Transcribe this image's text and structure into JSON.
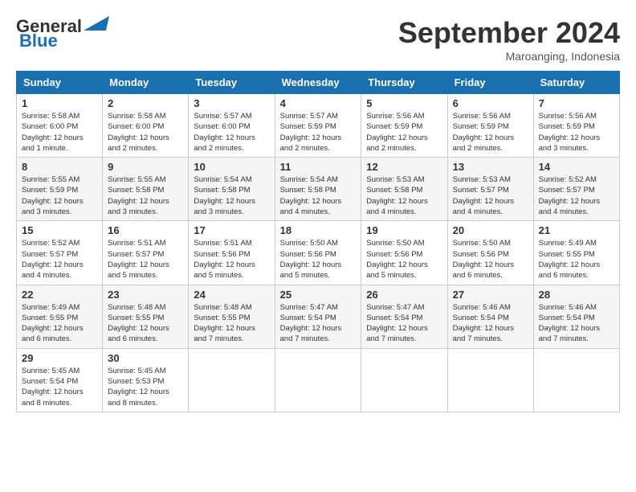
{
  "header": {
    "logo_general": "General",
    "logo_blue": "Blue",
    "month_title": "September 2024",
    "location": "Maroanging, Indonesia"
  },
  "days_of_week": [
    "Sunday",
    "Monday",
    "Tuesday",
    "Wednesday",
    "Thursday",
    "Friday",
    "Saturday"
  ],
  "weeks": [
    [
      {
        "day": "1",
        "sunrise": "5:58 AM",
        "sunset": "6:00 PM",
        "daylight": "12 hours and 1 minute."
      },
      {
        "day": "2",
        "sunrise": "5:58 AM",
        "sunset": "6:00 PM",
        "daylight": "12 hours and 2 minutes."
      },
      {
        "day": "3",
        "sunrise": "5:57 AM",
        "sunset": "6:00 PM",
        "daylight": "12 hours and 2 minutes."
      },
      {
        "day": "4",
        "sunrise": "5:57 AM",
        "sunset": "5:59 PM",
        "daylight": "12 hours and 2 minutes."
      },
      {
        "day": "5",
        "sunrise": "5:56 AM",
        "sunset": "5:59 PM",
        "daylight": "12 hours and 2 minutes."
      },
      {
        "day": "6",
        "sunrise": "5:56 AM",
        "sunset": "5:59 PM",
        "daylight": "12 hours and 2 minutes."
      },
      {
        "day": "7",
        "sunrise": "5:56 AM",
        "sunset": "5:59 PM",
        "daylight": "12 hours and 3 minutes."
      }
    ],
    [
      {
        "day": "8",
        "sunrise": "5:55 AM",
        "sunset": "5:59 PM",
        "daylight": "12 hours and 3 minutes."
      },
      {
        "day": "9",
        "sunrise": "5:55 AM",
        "sunset": "5:58 PM",
        "daylight": "12 hours and 3 minutes."
      },
      {
        "day": "10",
        "sunrise": "5:54 AM",
        "sunset": "5:58 PM",
        "daylight": "12 hours and 3 minutes."
      },
      {
        "day": "11",
        "sunrise": "5:54 AM",
        "sunset": "5:58 PM",
        "daylight": "12 hours and 4 minutes."
      },
      {
        "day": "12",
        "sunrise": "5:53 AM",
        "sunset": "5:58 PM",
        "daylight": "12 hours and 4 minutes."
      },
      {
        "day": "13",
        "sunrise": "5:53 AM",
        "sunset": "5:57 PM",
        "daylight": "12 hours and 4 minutes."
      },
      {
        "day": "14",
        "sunrise": "5:52 AM",
        "sunset": "5:57 PM",
        "daylight": "12 hours and 4 minutes."
      }
    ],
    [
      {
        "day": "15",
        "sunrise": "5:52 AM",
        "sunset": "5:57 PM",
        "daylight": "12 hours and 4 minutes."
      },
      {
        "day": "16",
        "sunrise": "5:51 AM",
        "sunset": "5:57 PM",
        "daylight": "12 hours and 5 minutes."
      },
      {
        "day": "17",
        "sunrise": "5:51 AM",
        "sunset": "5:56 PM",
        "daylight": "12 hours and 5 minutes."
      },
      {
        "day": "18",
        "sunrise": "5:50 AM",
        "sunset": "5:56 PM",
        "daylight": "12 hours and 5 minutes."
      },
      {
        "day": "19",
        "sunrise": "5:50 AM",
        "sunset": "5:56 PM",
        "daylight": "12 hours and 5 minutes."
      },
      {
        "day": "20",
        "sunrise": "5:50 AM",
        "sunset": "5:56 PM",
        "daylight": "12 hours and 6 minutes."
      },
      {
        "day": "21",
        "sunrise": "5:49 AM",
        "sunset": "5:55 PM",
        "daylight": "12 hours and 6 minutes."
      }
    ],
    [
      {
        "day": "22",
        "sunrise": "5:49 AM",
        "sunset": "5:55 PM",
        "daylight": "12 hours and 6 minutes."
      },
      {
        "day": "23",
        "sunrise": "5:48 AM",
        "sunset": "5:55 PM",
        "daylight": "12 hours and 6 minutes."
      },
      {
        "day": "24",
        "sunrise": "5:48 AM",
        "sunset": "5:55 PM",
        "daylight": "12 hours and 7 minutes."
      },
      {
        "day": "25",
        "sunrise": "5:47 AM",
        "sunset": "5:54 PM",
        "daylight": "12 hours and 7 minutes."
      },
      {
        "day": "26",
        "sunrise": "5:47 AM",
        "sunset": "5:54 PM",
        "daylight": "12 hours and 7 minutes."
      },
      {
        "day": "27",
        "sunrise": "5:46 AM",
        "sunset": "5:54 PM",
        "daylight": "12 hours and 7 minutes."
      },
      {
        "day": "28",
        "sunrise": "5:46 AM",
        "sunset": "5:54 PM",
        "daylight": "12 hours and 7 minutes."
      }
    ],
    [
      {
        "day": "29",
        "sunrise": "5:45 AM",
        "sunset": "5:54 PM",
        "daylight": "12 hours and 8 minutes."
      },
      {
        "day": "30",
        "sunrise": "5:45 AM",
        "sunset": "5:53 PM",
        "daylight": "12 hours and 8 minutes."
      },
      null,
      null,
      null,
      null,
      null
    ]
  ]
}
